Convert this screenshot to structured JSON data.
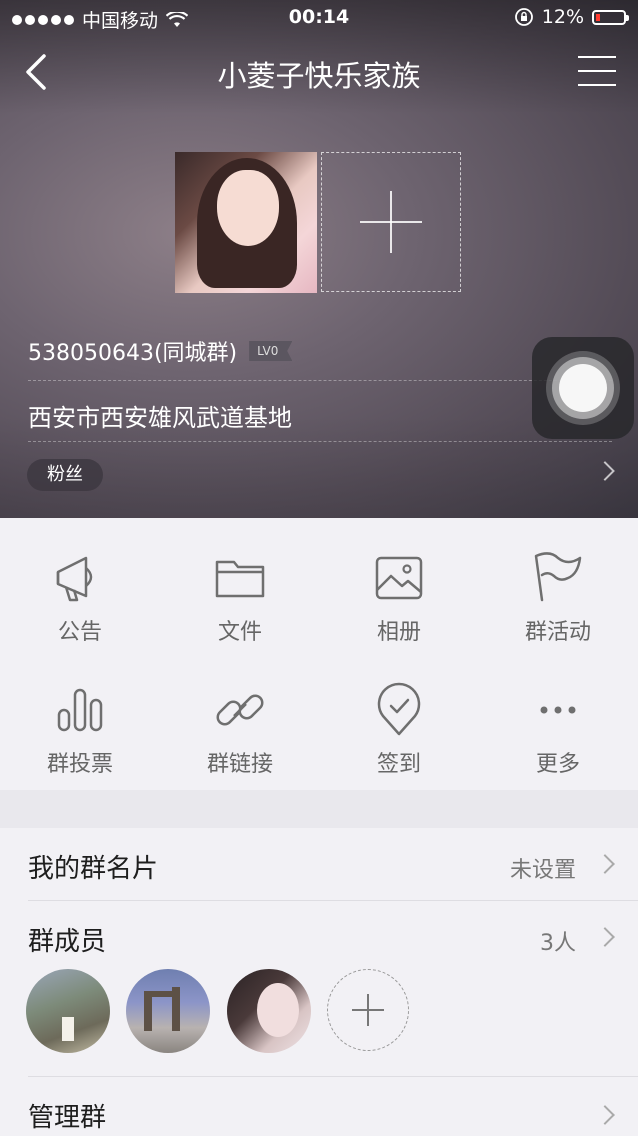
{
  "status_bar": {
    "carrier": "中国移动",
    "time": "00:14",
    "battery": "12%"
  },
  "header": {
    "title": "小菱子快乐家族"
  },
  "group": {
    "id_line": "538050643(同城群)",
    "level_badge": "LV0",
    "location": "西安市西安雄风武道基地",
    "tag": "粉丝"
  },
  "actions": [
    {
      "label": "公告",
      "icon": "megaphone-icon"
    },
    {
      "label": "文件",
      "icon": "folder-icon"
    },
    {
      "label": "相册",
      "icon": "image-icon"
    },
    {
      "label": "群活动",
      "icon": "flag-icon"
    },
    {
      "label": "群投票",
      "icon": "bar-chart-icon"
    },
    {
      "label": "群链接",
      "icon": "link-icon"
    },
    {
      "label": "签到",
      "icon": "checkin-pin-icon"
    },
    {
      "label": "更多",
      "icon": "more-dots-icon"
    }
  ],
  "list": {
    "card": {
      "title": "我的群名片",
      "value": "未设置"
    },
    "members": {
      "title": "群成员",
      "value": "3人"
    },
    "manage": {
      "title": "管理群"
    }
  },
  "colors": {
    "accent_low_battery": "#ff3b30",
    "icon_gray": "#6f6f6f"
  }
}
